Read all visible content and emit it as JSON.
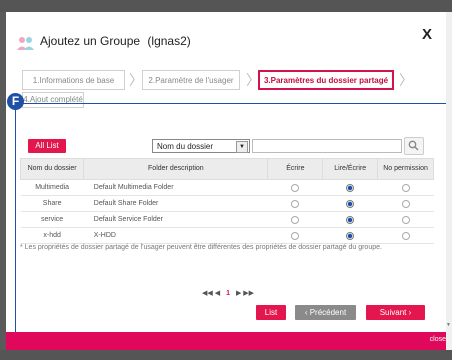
{
  "dialog": {
    "title": "Ajoutez un Groupe",
    "group_name": "(lgnas2)",
    "close_label": "X"
  },
  "steps": [
    {
      "label": "1.Informations de base",
      "active": false
    },
    {
      "label": "2.Paramètre de l'usager",
      "active": false
    },
    {
      "label": "3.Paramètres du dossier partagé",
      "active": true
    },
    {
      "label": "4.Ajout complété",
      "active": false
    }
  ],
  "annotation": {
    "marker_label": "F"
  },
  "toolbar": {
    "all_list_label": "All List",
    "filter_selected": "Nom du dossier",
    "search_value": ""
  },
  "table": {
    "headers": [
      "Nom du dossier",
      "Folder description",
      "Écrire",
      "Lire/Écrire",
      "No permission"
    ],
    "rows": [
      {
        "name": "Multimedia",
        "desc": "Default Multimedia Folder",
        "perm": "readwrite"
      },
      {
        "name": "Share",
        "desc": "Default Share Folder",
        "perm": "readwrite"
      },
      {
        "name": "service",
        "desc": "Default Service Folder",
        "perm": "readwrite"
      },
      {
        "name": "x-hdd",
        "desc": "X-HDD",
        "perm": "readwrite"
      }
    ]
  },
  "note": "* Les propriétés de dossier partagé de l'usager peuvent être différentes des propriétés de dossier partagé du groupe.",
  "pager": {
    "first": "◀◀",
    "prev": "◀",
    "current": "1",
    "next": "▶",
    "last": "▶▶"
  },
  "buttons": {
    "list": "List",
    "prev": "‹ Précédent",
    "next": "Suivant ›"
  },
  "footer": {
    "text": "close"
  },
  "colors": {
    "accent": "#e3174e",
    "marker": "#1f50a8",
    "footer": "#e0085a"
  }
}
